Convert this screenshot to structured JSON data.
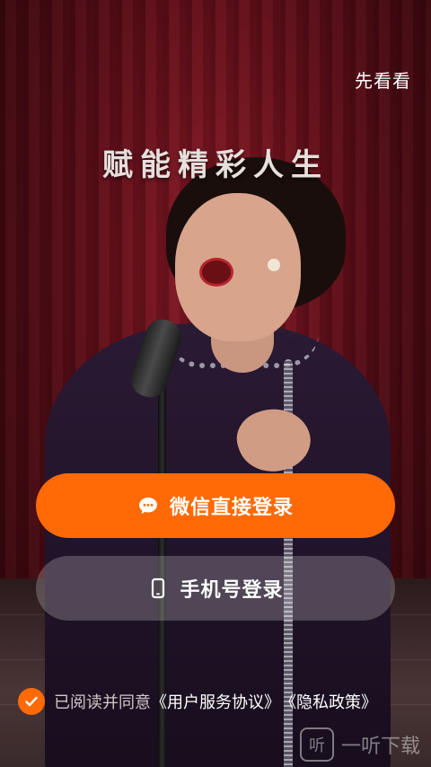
{
  "header": {
    "skip_label": "先看看"
  },
  "hero": {
    "slogan": "赋能精彩人生"
  },
  "buttons": {
    "wechat_login": "微信直接登录",
    "phone_login": "手机号登录"
  },
  "agreement": {
    "checked": true,
    "prefix": "已阅读并同意",
    "user_agreement": "《用户服务协议》",
    "privacy_policy": "《隐私政策》"
  },
  "watermark": {
    "text": "一听下载",
    "icon_glyph": "听"
  },
  "colors": {
    "accent": "#ff6a07",
    "secondary_button": "rgba(255,255,255,0.22)"
  },
  "icons": {
    "wechat": "chat-bubble-icon",
    "phone": "mobile-phone-icon",
    "check": "checkmark-icon"
  }
}
